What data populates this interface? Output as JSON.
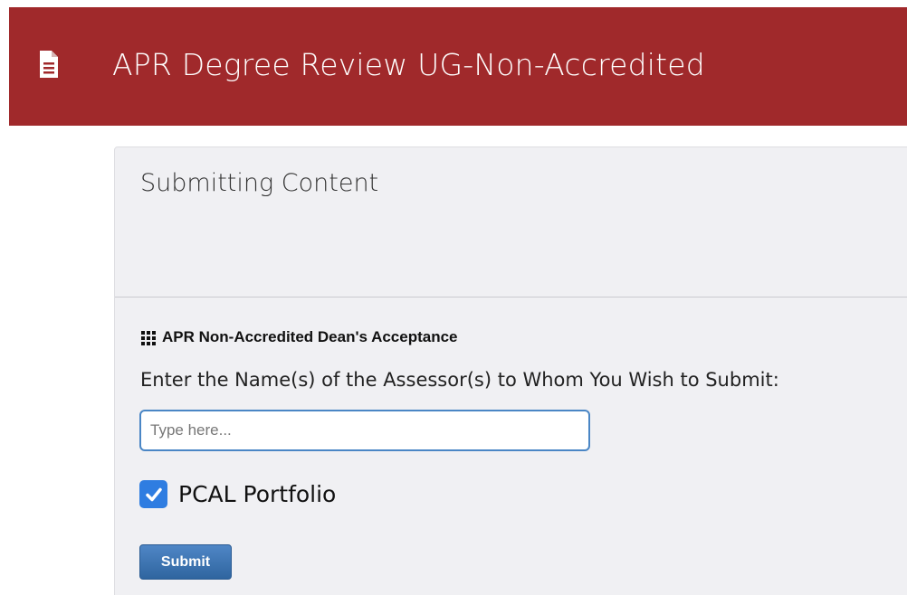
{
  "header": {
    "title": "APR Degree Review UG-Non-Accredited",
    "icon": "document-icon",
    "background_color": "#a0292b"
  },
  "panel": {
    "title": "Submitting Content",
    "section": {
      "icon": "grid-icon",
      "title": "APR Non-Accredited Dean's Acceptance"
    },
    "prompt": "Enter the Name(s) of the Assessor(s) to Whom You Wish to Submit:",
    "assessor_input": {
      "value": "",
      "placeholder": "Type here..."
    },
    "checkbox": {
      "checked": true,
      "label": "PCAL Portfolio"
    },
    "submit_label": "Submit"
  }
}
